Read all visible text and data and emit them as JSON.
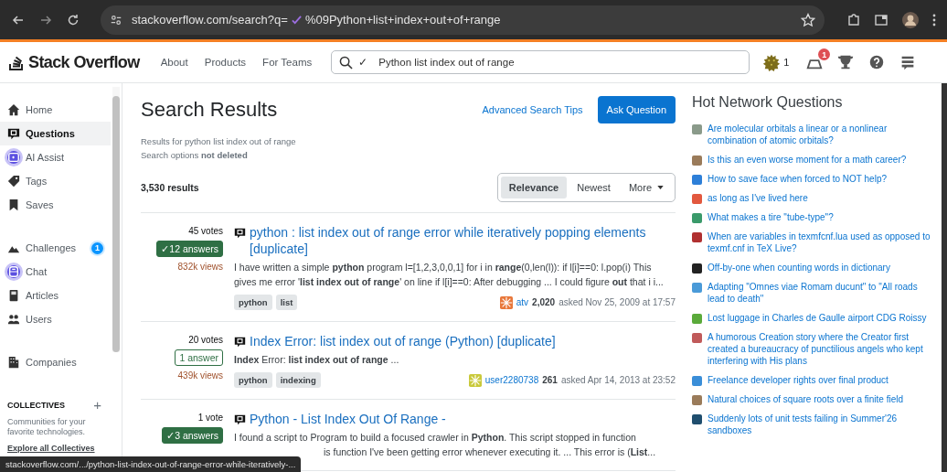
{
  "browser": {
    "url_start": "stackoverflow.com/search?q=",
    "url_end": "%09Python+list+index+out+of+range"
  },
  "header": {
    "logo": "Stack Overflow",
    "nav": [
      "About",
      "Products",
      "For Teams"
    ],
    "search_mark": "✓",
    "search_value": "Python list index out of range",
    "reputation": "1",
    "inbox_count": "1"
  },
  "sidebar": {
    "sections": [
      {
        "items": [
          {
            "label": "Home",
            "kind": "home",
            "selected": false,
            "highlight": false
          },
          {
            "label": "Questions",
            "kind": "questions",
            "selected": true,
            "highlight": false
          },
          {
            "label": "AI Assist",
            "kind": "ai",
            "selected": false,
            "highlight": true
          },
          {
            "label": "Tags",
            "kind": "tag",
            "selected": false,
            "highlight": false
          },
          {
            "label": "Saves",
            "kind": "bookmark",
            "selected": false,
            "highlight": false
          }
        ]
      },
      {
        "items": [
          {
            "label": "Challenges",
            "kind": "mountain",
            "selected": false,
            "highlight": false,
            "badge": "1"
          },
          {
            "label": "Chat",
            "kind": "chat",
            "selected": false,
            "highlight": true
          },
          {
            "label": "Articles",
            "kind": "article",
            "selected": false,
            "highlight": false
          },
          {
            "label": "Users",
            "kind": "users",
            "selected": false,
            "highlight": false
          }
        ]
      },
      {
        "items": [
          {
            "label": "Companies",
            "kind": "building",
            "selected": false,
            "highlight": false
          }
        ]
      }
    ],
    "collectives": {
      "title": "COLLECTIVES",
      "add": "+",
      "text": "Communities for your favorite technologies.",
      "link": "Explore all Collectives"
    }
  },
  "main": {
    "title": "Search Results",
    "tips_link": "Advanced Search Tips",
    "ask_button": "Ask Question",
    "results_for": "Results for python list index out of range",
    "options": "Search options **not deleted**",
    "count": "3,530 results",
    "sort": [
      {
        "label": "Relevance",
        "selected": true
      },
      {
        "label": "Newest",
        "selected": false
      },
      {
        "label": "More",
        "selected": false,
        "dropdown": true
      }
    ],
    "questions": [
      {
        "votes": "45 votes",
        "answers": "12 answers",
        "accepted": true,
        "mark": "✓",
        "views": "832k views",
        "title": "python : list index out of range error while iteratively popping elements [duplicate]",
        "excerpt": [
          "I have written a simple **python** program l=[1,2,3,0,0,1] for i in **range**(0,len(l)): if l[i]==0: l.pop(i) This gives me error '**list index out of range**' on line if l[i]==0: After debugging ... I could figure **out** that i i..."
        ],
        "tags": [
          "python",
          "list"
        ],
        "user": "atv",
        "rep": "2,020",
        "asked": "asked Nov 25, 2009 at 17:57"
      },
      {
        "votes": "20 votes",
        "answers": "1 answer",
        "accepted": false,
        "views": "439k views",
        "title": "Index Error: list index out of range (Python) [duplicate]",
        "excerpt": [
          "**Index** Error: **list index out of range** ..."
        ],
        "tags": [
          "python",
          "indexing"
        ],
        "user": "user2280738",
        "rep": "261",
        "asked": "asked Apr 14, 2013 at 23:52"
      },
      {
        "votes": "1 vote",
        "answers": "3 answers",
        "accepted": true,
        "mark": "✓",
        "title": "Python - List Index Out Of Range -",
        "excerpt": [
          "I found a script to Program to build a focused crawler in **Python**. This script stopped in function",
          "is function I've been getting error whenever executing it. ... This error is (**List**..."
        ]
      }
    ]
  },
  "hot": {
    "title": "Hot Network Questions",
    "items": [
      {
        "text": "Are molecular orbitals a linear or a nonlinear combination of atomic orbitals?",
        "color": "#8a9a8a"
      },
      {
        "text": "Is this an even worse moment for a math career?",
        "color": "#9a7b5a"
      },
      {
        "text": "How to save face when forced to NOT help?",
        "color": "#2d7fd8"
      },
      {
        "text": "as long as I've lived here",
        "color": "#e2583e"
      },
      {
        "text": "What makes a tire \"tube-type\"?",
        "color": "#3a9a6a"
      },
      {
        "text": "When are variables in texmfcnf.lua used as opposed to texmf.cnf in TeX Live?",
        "color": "#b03030"
      },
      {
        "text": "Off-by-one when counting words in dictionary",
        "color": "#222222"
      },
      {
        "text": "Adapting \"Omnes viae Romam ducunt\" to \"All roads lead to death\"",
        "color": "#4a9ad8"
      },
      {
        "text": "Lost luggage in Charles de Gaulle airport CDG Roissy",
        "color": "#5aaa3a"
      },
      {
        "text": "A humorous Creation story where the Creator first created a bureaucracy of punctilious angels who kept interfering with His plans",
        "color": "#c05a5a"
      },
      {
        "text": "Freelance developer rights over final product",
        "color": "#3a8ed8"
      },
      {
        "text": "Natural choices of square roots over a finite field",
        "color": "#9a7b5a"
      },
      {
        "text": "Suddenly lots of unit tests failing in Summer'26 sandboxes",
        "color": "#1f4e6e"
      }
    ]
  },
  "status_bar": "stackoverflow.com/.../python-list-index-out-of-range-error-while-iteratively-..."
}
